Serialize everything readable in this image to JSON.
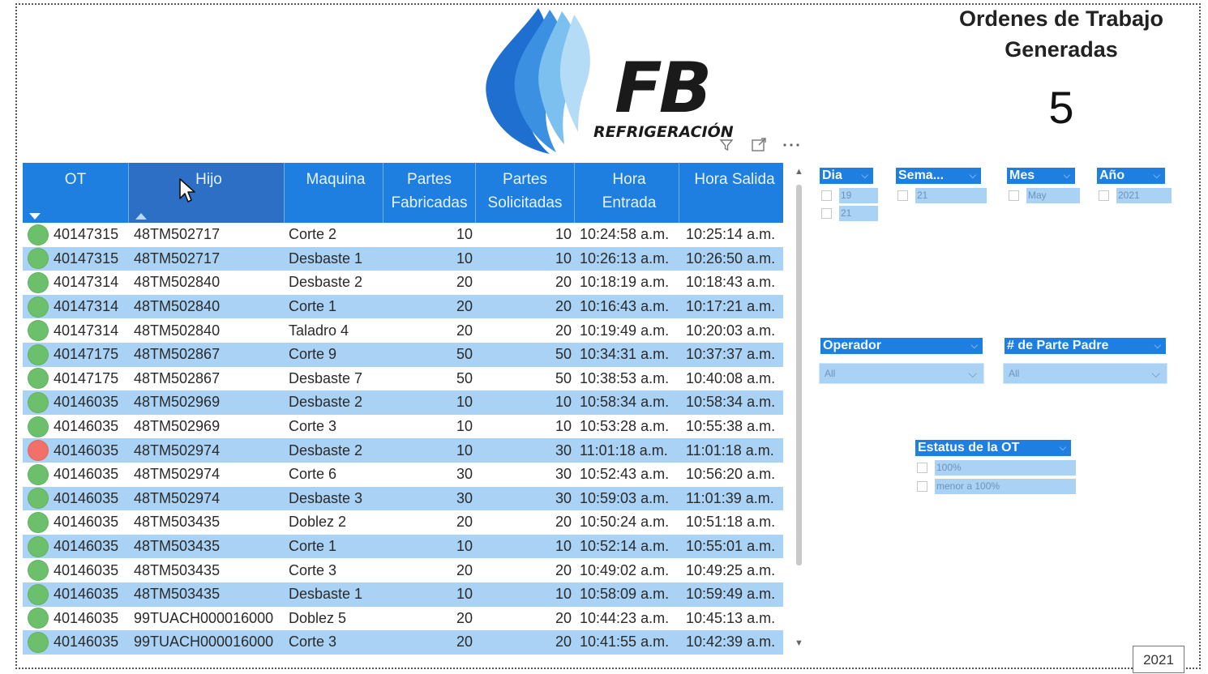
{
  "logo": {
    "brand": "FB",
    "tagline": "REFRIGERACIÓN"
  },
  "kpi": {
    "title_line1": "Ordenes de Trabajo",
    "title_line2": "Generadas",
    "value": "5"
  },
  "table": {
    "columns": [
      {
        "line1": "OT",
        "line2": ""
      },
      {
        "line1": "Hijo",
        "line2": ""
      },
      {
        "line1": "Maquina",
        "line2": ""
      },
      {
        "line1": "Partes",
        "line2": "Fabricadas"
      },
      {
        "line1": "Partes",
        "line2": "Solicitadas"
      },
      {
        "line1": "Hora",
        "line2": "Entrada"
      },
      {
        "line1": "Hora Salida",
        "line2": ""
      }
    ],
    "rows": [
      {
        "status": "green",
        "ot": "40147315",
        "hijo": "48TM502717",
        "maquina": "Corte 2",
        "fab": "10",
        "sol": "10",
        "entrada": "10:24:58 a.m.",
        "salida": "10:25:14 a.m."
      },
      {
        "status": "green",
        "ot": "40147315",
        "hijo": "48TM502717",
        "maquina": "Desbaste 1",
        "fab": "10",
        "sol": "10",
        "entrada": "10:26:13 a.m.",
        "salida": "10:26:50 a.m."
      },
      {
        "status": "green",
        "ot": "40147314",
        "hijo": "48TM502840",
        "maquina": "Desbaste 2",
        "fab": "20",
        "sol": "20",
        "entrada": "10:18:19 a.m.",
        "salida": "10:18:43 a.m."
      },
      {
        "status": "green",
        "ot": "40147314",
        "hijo": "48TM502840",
        "maquina": "Corte 1",
        "fab": "20",
        "sol": "20",
        "entrada": "10:16:43 a.m.",
        "salida": "10:17:21 a.m."
      },
      {
        "status": "green",
        "ot": "40147314",
        "hijo": "48TM502840",
        "maquina": "Taladro 4",
        "fab": "20",
        "sol": "20",
        "entrada": "10:19:49 a.m.",
        "salida": "10:20:03 a.m."
      },
      {
        "status": "green",
        "ot": "40147175",
        "hijo": "48TM502867",
        "maquina": "Corte 9",
        "fab": "50",
        "sol": "50",
        "entrada": "10:34:31 a.m.",
        "salida": "10:37:37 a.m."
      },
      {
        "status": "green",
        "ot": "40147175",
        "hijo": "48TM502867",
        "maquina": "Desbaste 7",
        "fab": "50",
        "sol": "50",
        "entrada": "10:38:53 a.m.",
        "salida": "10:40:08 a.m."
      },
      {
        "status": "green",
        "ot": "40146035",
        "hijo": "48TM502969",
        "maquina": "Desbaste 2",
        "fab": "10",
        "sol": "10",
        "entrada": "10:58:34 a.m.",
        "salida": "10:58:34 a.m."
      },
      {
        "status": "green",
        "ot": "40146035",
        "hijo": "48TM502969",
        "maquina": "Corte 3",
        "fab": "10",
        "sol": "10",
        "entrada": "10:53:28 a.m.",
        "salida": "10:55:38 a.m."
      },
      {
        "status": "red",
        "ot": "40146035",
        "hijo": "48TM502974",
        "maquina": "Desbaste 2",
        "fab": "10",
        "sol": "30",
        "entrada": "11:01:18 a.m.",
        "salida": "11:01:18 a.m."
      },
      {
        "status": "green",
        "ot": "40146035",
        "hijo": "48TM502974",
        "maquina": "Corte 6",
        "fab": "30",
        "sol": "30",
        "entrada": "10:52:43 a.m.",
        "salida": "10:56:20 a.m."
      },
      {
        "status": "green",
        "ot": "40146035",
        "hijo": "48TM502974",
        "maquina": "Desbaste 3",
        "fab": "30",
        "sol": "30",
        "entrada": "10:59:03 a.m.",
        "salida": "11:01:39 a.m."
      },
      {
        "status": "green",
        "ot": "40146035",
        "hijo": "48TM503435",
        "maquina": "Doblez 2",
        "fab": "20",
        "sol": "20",
        "entrada": "10:50:24 a.m.",
        "salida": "10:51:18 a.m."
      },
      {
        "status": "green",
        "ot": "40146035",
        "hijo": "48TM503435",
        "maquina": "Corte 1",
        "fab": "10",
        "sol": "10",
        "entrada": "10:52:14 a.m.",
        "salida": "10:55:01 a.m."
      },
      {
        "status": "green",
        "ot": "40146035",
        "hijo": "48TM503435",
        "maquina": "Corte 3",
        "fab": "20",
        "sol": "20",
        "entrada": "10:49:02 a.m.",
        "salida": "10:49:25 a.m."
      },
      {
        "status": "green",
        "ot": "40146035",
        "hijo": "48TM503435",
        "maquina": "Desbaste 1",
        "fab": "10",
        "sol": "10",
        "entrada": "10:58:09 a.m.",
        "salida": "10:59:49 a.m."
      },
      {
        "status": "green",
        "ot": "40146035",
        "hijo": "99TUACH000016000",
        "maquina": "Doblez 5",
        "fab": "20",
        "sol": "20",
        "entrada": "10:44:23 a.m.",
        "salida": "10:45:13 a.m."
      },
      {
        "status": "green",
        "ot": "40146035",
        "hijo": "99TUACH000016000",
        "maquina": "Corte 3",
        "fab": "20",
        "sol": "20",
        "entrada": "10:41:55 a.m.",
        "salida": "10:42:39 a.m."
      }
    ]
  },
  "slicers": {
    "dia": {
      "title": "Dia",
      "items": [
        "19",
        "21"
      ]
    },
    "semana": {
      "title": "Sema...",
      "items": [
        "21"
      ]
    },
    "mes": {
      "title": "Mes",
      "items": [
        "May"
      ]
    },
    "anio": {
      "title": "Año",
      "items": [
        "2021"
      ]
    },
    "operador": {
      "title": "Operador",
      "value": "All"
    },
    "parte_padre": {
      "title": "# de Parte Padre",
      "value": "All"
    },
    "estatus": {
      "title": "Estatus de la OT",
      "items": [
        "100%",
        "menor a 100%"
      ]
    }
  },
  "page_tab": "2021",
  "colors": {
    "accent": "#1e7fe0",
    "row_alt": "#a9d2f5",
    "status_green": "#6cc06b",
    "status_red": "#f2706a"
  }
}
